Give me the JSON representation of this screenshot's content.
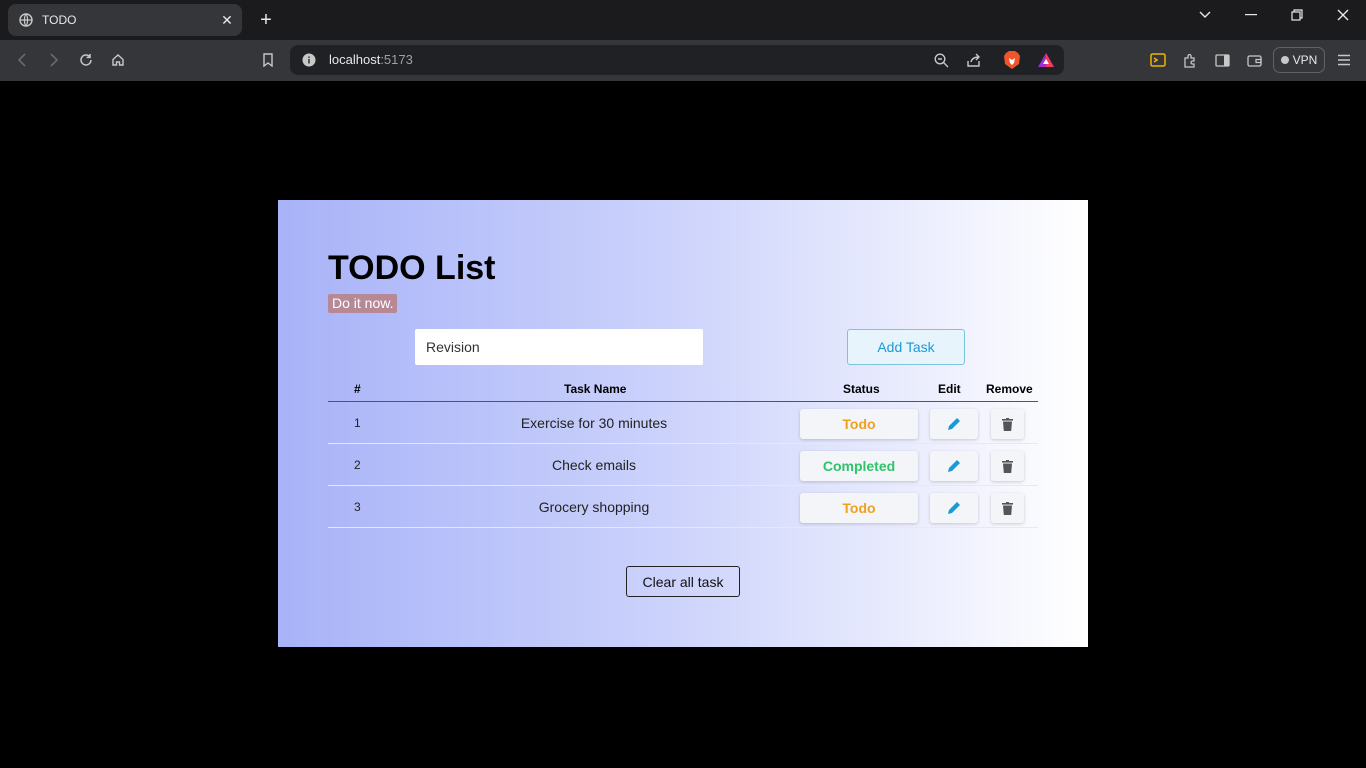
{
  "browser": {
    "tab_title": "TODO",
    "url_host": "localhost",
    "url_port": ":5173",
    "vpn_label": "VPN"
  },
  "app": {
    "title": "TODO List",
    "tagline": "Do it now.",
    "input_value": "Revision",
    "add_button": "Add Task",
    "clear_button": "Clear all task",
    "columns": {
      "num": "#",
      "name": "Task Name",
      "status": "Status",
      "edit": "Edit",
      "remove": "Remove"
    },
    "tasks": [
      {
        "num": "1",
        "name": "Exercise for 30 minutes",
        "status": "Todo"
      },
      {
        "num": "2",
        "name": "Check emails",
        "status": "Completed"
      },
      {
        "num": "3",
        "name": "Grocery shopping",
        "status": "Todo"
      }
    ],
    "colors": {
      "todo": "#f0a020",
      "completed": "#2ec46a",
      "accent": "#1a9ad6",
      "tagline_bg": "#b78896"
    }
  }
}
